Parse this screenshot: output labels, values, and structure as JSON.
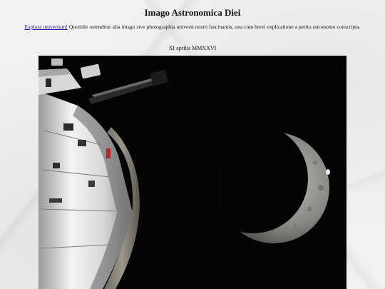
{
  "header": {
    "title": "Imago Astronomica Diei"
  },
  "intro": {
    "link_label": "Explora universum!",
    "text": " Quotidie ostenditur alia imago sive photographia universi nostri fascinantis, una cum brevi explicatione a perito astronomo conscripta."
  },
  "date": "XI aprilis MMXXVI",
  "image": {
    "subject": "spacecraft-and-crescent-moon-photo"
  }
}
